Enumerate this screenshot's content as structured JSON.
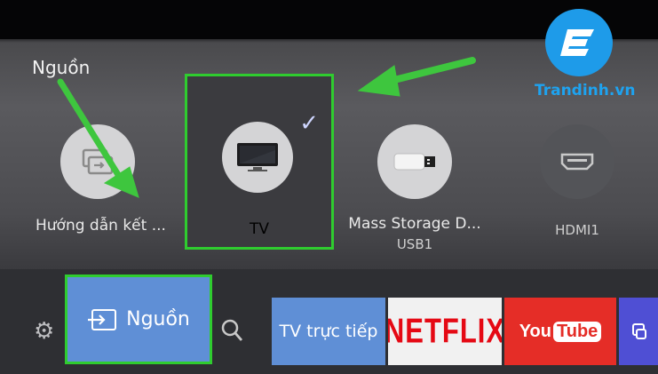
{
  "panel": {
    "title": "Nguồn"
  },
  "sources": [
    {
      "label": "Hướng dẫn kết ...",
      "icon": "connection-guide-icon"
    },
    {
      "label": "TV",
      "icon": "tv-icon",
      "selected": true
    },
    {
      "label": "Mass Storage D...",
      "sublabel": "USB1",
      "icon": "usb-icon"
    },
    {
      "label": "HDMI1",
      "icon": "hdmi-icon"
    }
  ],
  "checkmark": "✓",
  "bottom_bar": {
    "source_button": "Nguồn",
    "tiles": [
      "TV trực tiếp",
      "NETFLIX",
      "You",
      "Tube"
    ]
  },
  "watermark": {
    "text": "Trandinh.vn"
  },
  "colors": {
    "highlight": "#2fcc2f",
    "accent_blue": "#5f8fd6",
    "arrow": "#3ec63e",
    "youtube": "#e52d27",
    "netflix": "#e50914"
  }
}
